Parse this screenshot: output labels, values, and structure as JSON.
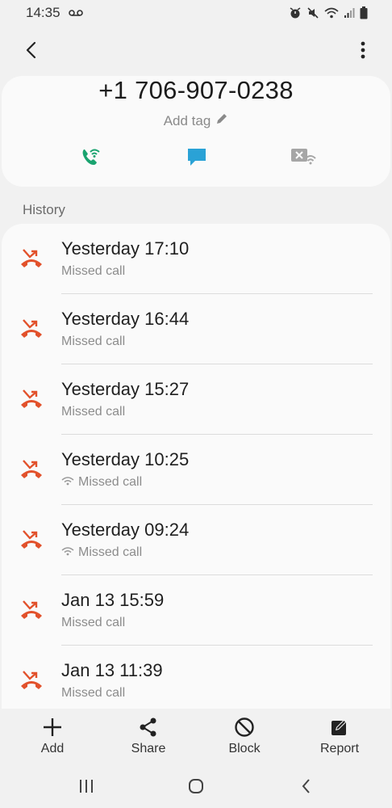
{
  "status_bar": {
    "time": "14:35",
    "icons": [
      "voicemail-icon",
      "alarm-icon",
      "mute-icon",
      "wifi-icon",
      "signal-icon",
      "battery-icon"
    ]
  },
  "app_bar": {
    "back_icon": "back-arrow-icon",
    "more_icon": "more-vert-icon"
  },
  "contact": {
    "phone_number": "+1 706-907-0238",
    "add_tag_label": "Add tag",
    "actions": [
      "wifi-call-icon",
      "message-icon",
      "video-call-icon"
    ]
  },
  "history": {
    "title": "History",
    "items": [
      {
        "time": "Yesterday 17:10",
        "type": "Missed call",
        "wifi": false
      },
      {
        "time": "Yesterday 16:44",
        "type": "Missed call",
        "wifi": false
      },
      {
        "time": "Yesterday 15:27",
        "type": "Missed call",
        "wifi": false
      },
      {
        "time": "Yesterday 10:25",
        "type": "Missed call",
        "wifi": true
      },
      {
        "time": "Yesterday 09:24",
        "type": "Missed call",
        "wifi": true
      },
      {
        "time": "Jan 13 15:59",
        "type": "Missed call",
        "wifi": false
      },
      {
        "time": "Jan 13 11:39",
        "type": "Missed call",
        "wifi": false
      }
    ]
  },
  "toolbar": {
    "add_label": "Add",
    "share_label": "Share",
    "block_label": "Block",
    "report_label": "Report"
  },
  "colors": {
    "missed_call": "#e2512b",
    "call_green": "#1aa36f",
    "message_blue": "#2aa2d6",
    "video_gray": "#a6a6a6"
  }
}
